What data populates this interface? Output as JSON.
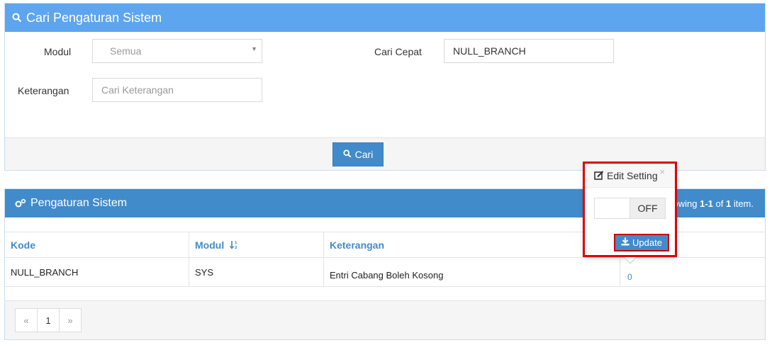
{
  "search_panel": {
    "title": "Cari Pengaturan Sistem",
    "modul_label": "Modul",
    "modul_value": "Semua",
    "cari_cepat_label": "Cari Cepat",
    "cari_cepat_value": "NULL_BRANCH",
    "keterangan_label": "Keterangan",
    "keterangan_placeholder": "Cari Keterangan",
    "search_button": "Cari"
  },
  "grid_panel": {
    "title": "Pengaturan Sistem",
    "summary_prefix": "owing ",
    "summary_range": "1-1",
    "summary_of": " of ",
    "summary_total": "1",
    "summary_suffix": " item.",
    "columns": [
      "Kode",
      "Modul",
      "Keterangan"
    ],
    "rows": [
      {
        "kode": "NULL_BRANCH",
        "modul": "SYS",
        "keterangan": "Entri Cabang Boleh Kosong",
        "value": "0"
      }
    ]
  },
  "pagination": {
    "prev": "«",
    "current": "1",
    "next": "»"
  },
  "popover": {
    "title": "Edit Setting",
    "close": "×",
    "toggle_state": "OFF",
    "update_button": "Update"
  },
  "colors": {
    "header_light": "#5da5ee",
    "header_dark": "#428bca",
    "highlight": "#e00000"
  }
}
